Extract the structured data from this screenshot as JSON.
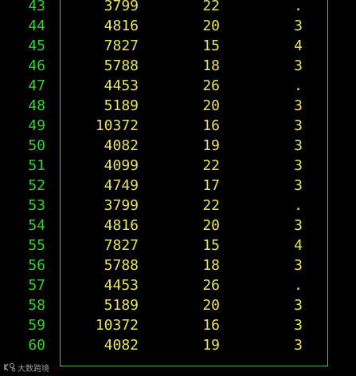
{
  "theme": {
    "background": "#000000",
    "line_number_color": "#34d134",
    "value_color": "#e7e36b",
    "frame_color": "#3ecf3e"
  },
  "rows": [
    {
      "line": "43",
      "a": "3799",
      "b": "22",
      "c": "."
    },
    {
      "line": "44",
      "a": "4816",
      "b": "20",
      "c": "3"
    },
    {
      "line": "45",
      "a": "7827",
      "b": "15",
      "c": "4"
    },
    {
      "line": "46",
      "a": "5788",
      "b": "18",
      "c": "3"
    },
    {
      "line": "47",
      "a": "4453",
      "b": "26",
      "c": "."
    },
    {
      "line": "48",
      "a": "5189",
      "b": "20",
      "c": "3"
    },
    {
      "line": "49",
      "a": "10372",
      "b": "16",
      "c": "3"
    },
    {
      "line": "50",
      "a": "4082",
      "b": "19",
      "c": "3"
    },
    {
      "line": "51",
      "a": "4099",
      "b": "22",
      "c": "3"
    },
    {
      "line": "52",
      "a": "4749",
      "b": "17",
      "c": "3"
    },
    {
      "line": "53",
      "a": "3799",
      "b": "22",
      "c": "."
    },
    {
      "line": "54",
      "a": "4816",
      "b": "20",
      "c": "3"
    },
    {
      "line": "55",
      "a": "7827",
      "b": "15",
      "c": "4"
    },
    {
      "line": "56",
      "a": "5788",
      "b": "18",
      "c": "3"
    },
    {
      "line": "57",
      "a": "4453",
      "b": "26",
      "c": "."
    },
    {
      "line": "58",
      "a": "5189",
      "b": "20",
      "c": "3"
    },
    {
      "line": "59",
      "a": "10372",
      "b": "16",
      "c": "3"
    },
    {
      "line": "60",
      "a": "4082",
      "b": "19",
      "c": "3"
    }
  ],
  "watermark": {
    "text": "大数跨境",
    "icon": "brand-logo-icon"
  }
}
